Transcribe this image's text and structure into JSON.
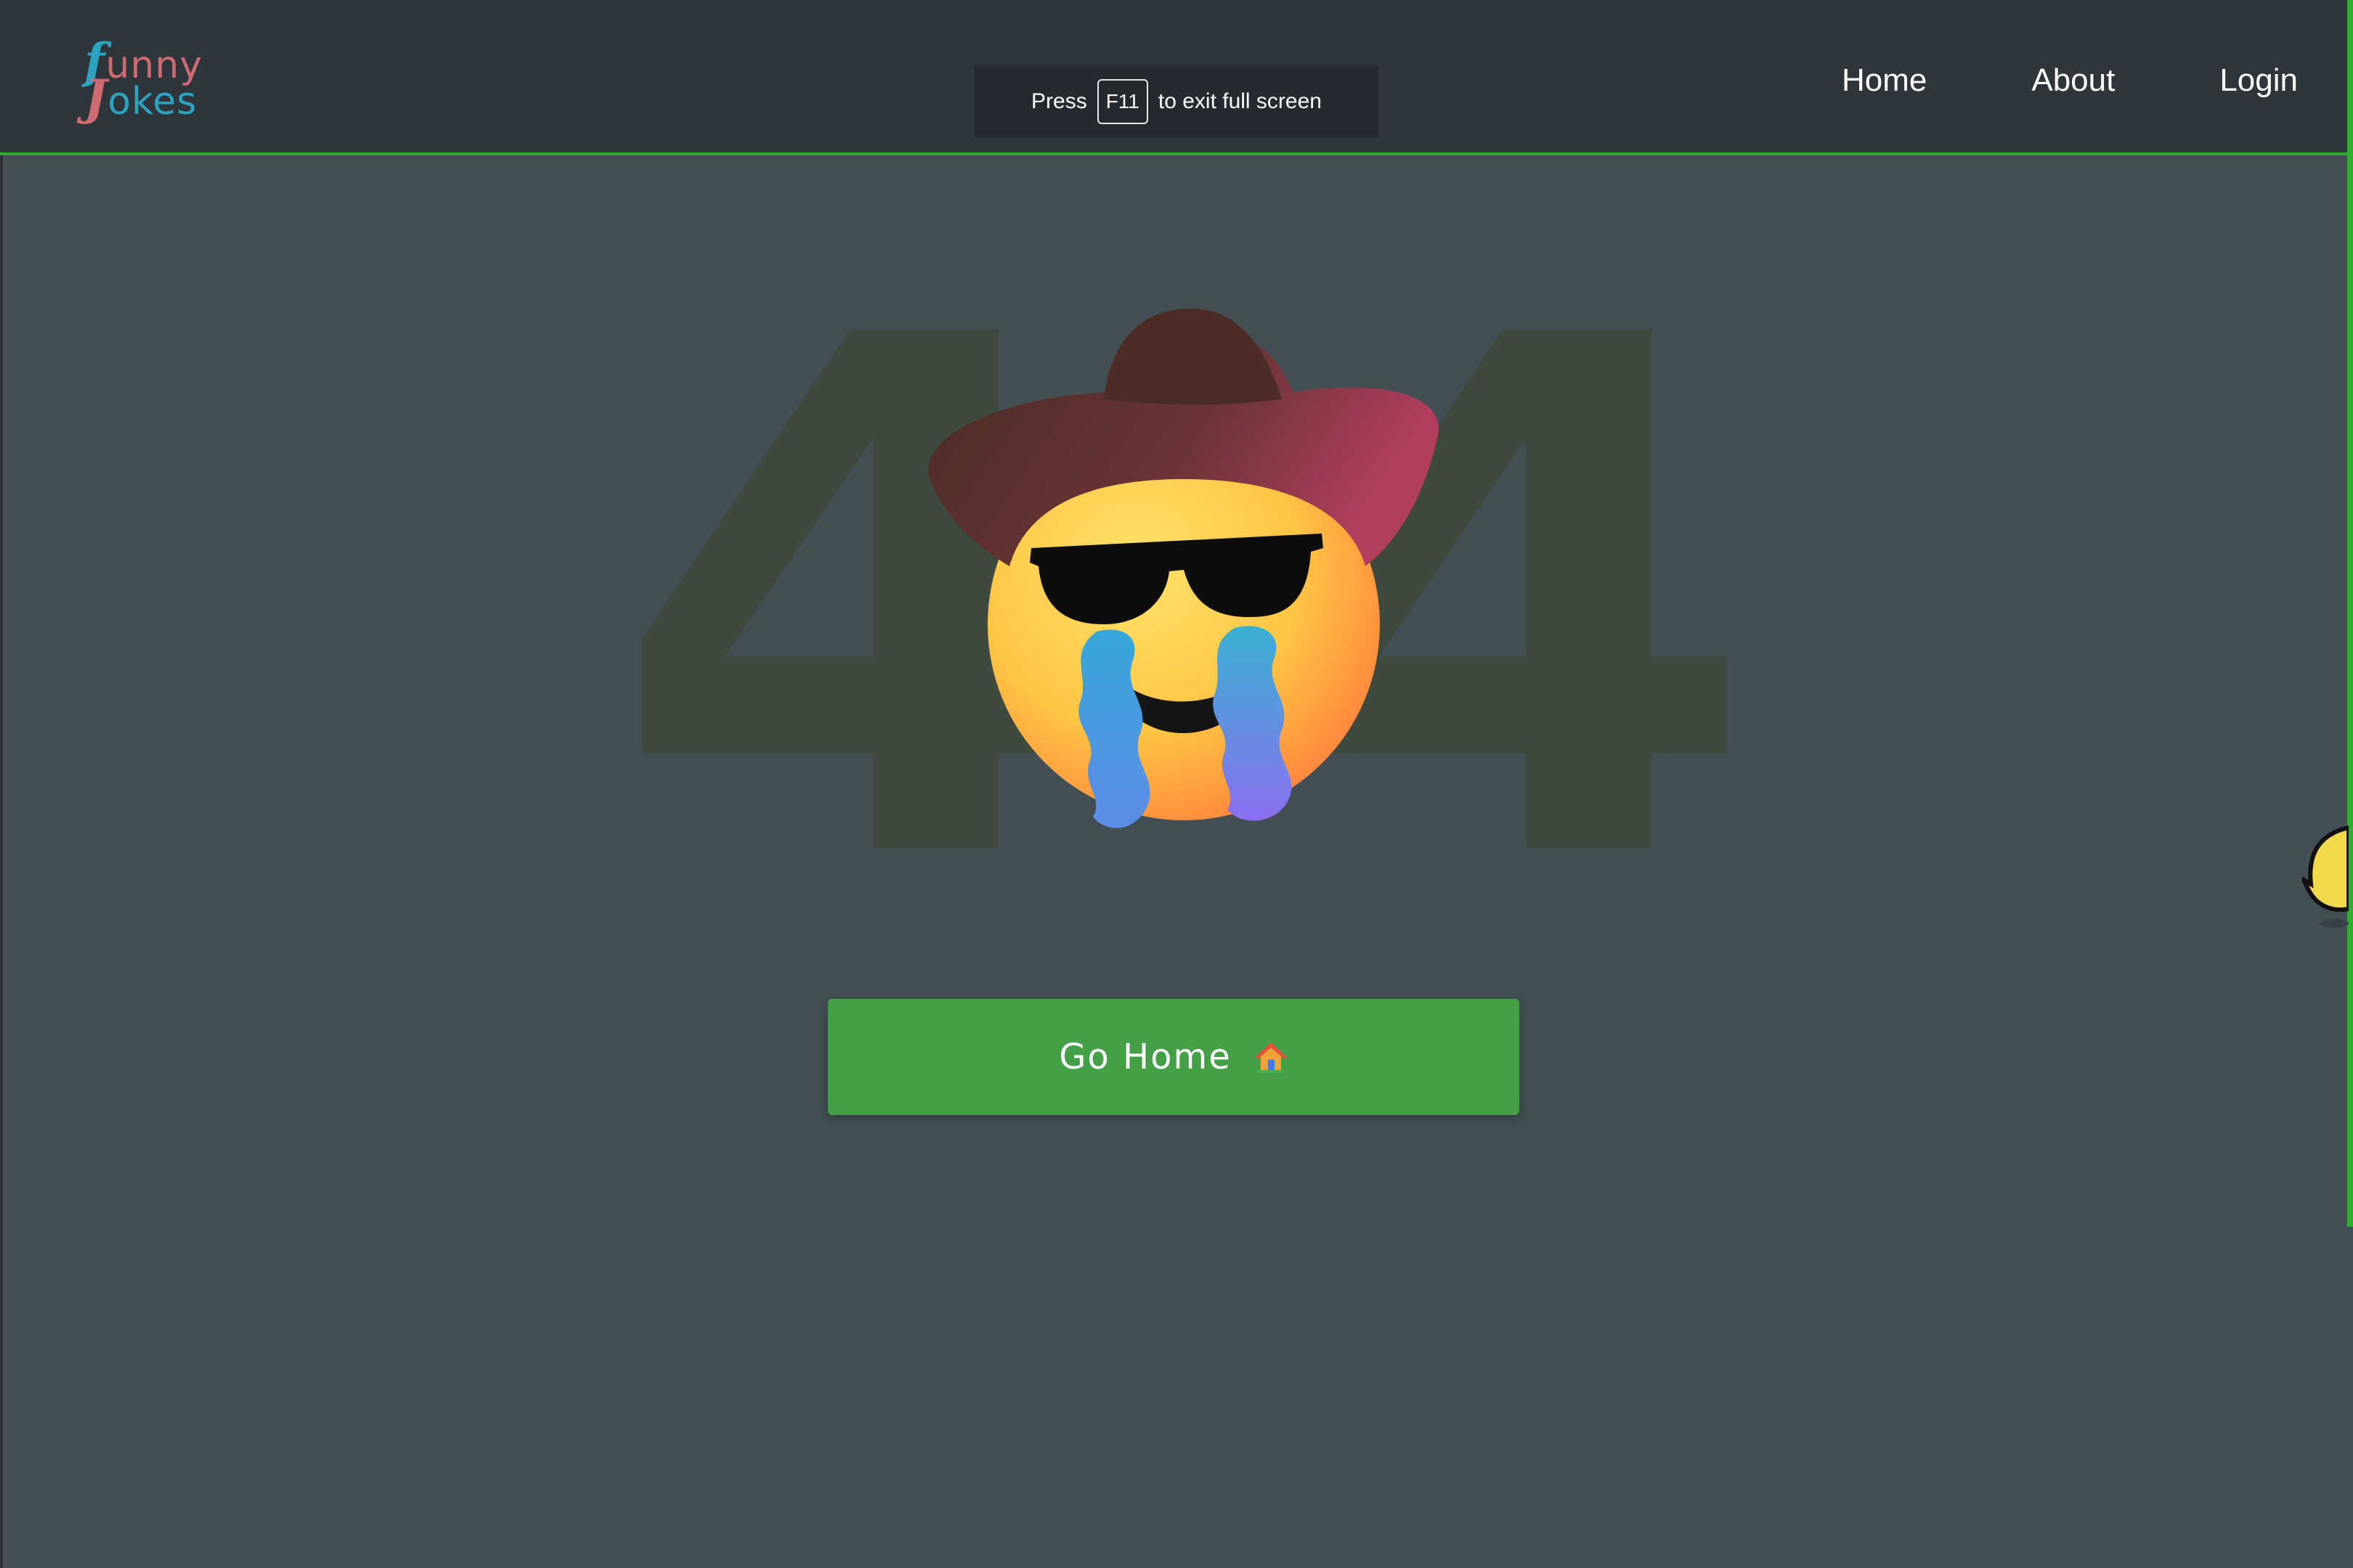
{
  "logo": {
    "line1": "unny",
    "line2": "okes",
    "cap1": "f",
    "cap2": "J"
  },
  "fullscreen_notice": {
    "before": "Press",
    "key": "F11",
    "after": "to exit full screen"
  },
  "nav": {
    "items": [
      {
        "label": "Home"
      },
      {
        "label": "About"
      },
      {
        "label": "Login"
      }
    ]
  },
  "error": {
    "digit_left": "4",
    "digit_right": "4"
  },
  "cta": {
    "label": "Go Home",
    "icon": "house-icon"
  },
  "colors": {
    "background": "#424f54",
    "header": "#2f363b",
    "accent_green": "#2fae2f",
    "button": "#43a047",
    "logo_teal": "#2ea3c0",
    "logo_red": "#cd6a73"
  }
}
